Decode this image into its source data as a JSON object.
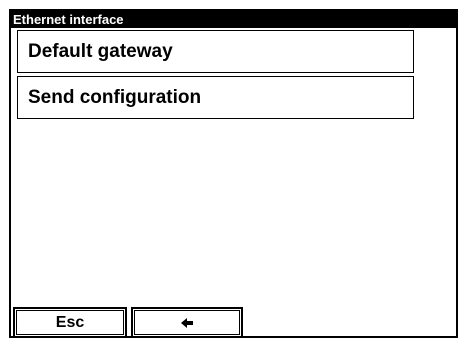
{
  "window": {
    "title": "Ethernet interface"
  },
  "menu": {
    "items": [
      {
        "label": "Default gateway"
      },
      {
        "label": "Send configuration"
      }
    ]
  },
  "softkeys": {
    "esc_label": "Esc",
    "back_icon": "arrow-left-icon"
  }
}
